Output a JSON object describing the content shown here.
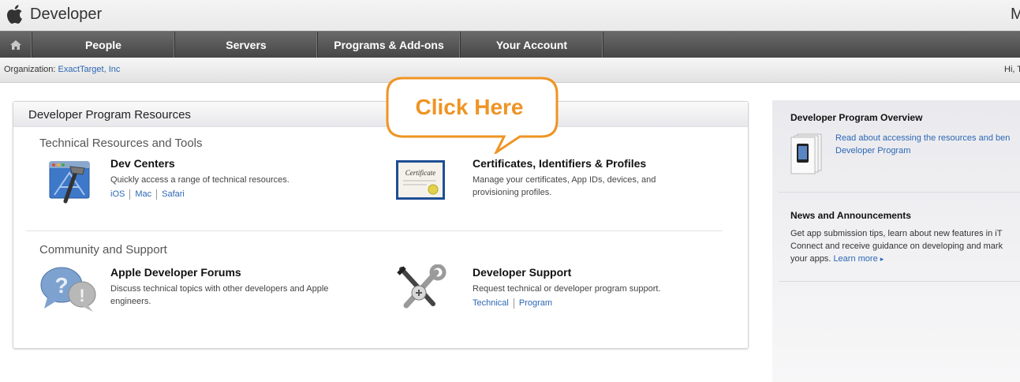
{
  "header": {
    "brand": "Developer",
    "brand_right": "M"
  },
  "nav": {
    "home_icon": "home-icon",
    "items": [
      "People",
      "Servers",
      "Programs & Add-ons",
      "Your Account"
    ]
  },
  "org": {
    "label": "Organization:",
    "name": "ExactTarget, Inc",
    "greeting": "Hi, T"
  },
  "main": {
    "panel_title": "Developer Program Resources",
    "sections": [
      {
        "title": "Technical Resources and Tools",
        "items": [
          {
            "title": "Dev Centers",
            "icon": "xcode-hammer-icon",
            "desc": "Quickly access a range of technical resources.",
            "links": [
              "iOS",
              "Mac",
              "Safari"
            ]
          },
          {
            "title": "Certificates, Identifiers & Profiles",
            "icon": "certificate-icon",
            "icon_text": "Certificate",
            "desc": "Manage your certificates, App IDs, devices, and provisioning profiles.",
            "links": []
          }
        ]
      },
      {
        "title": "Community and Support",
        "items": [
          {
            "title": "Apple Developer Forums",
            "icon": "forums-bubbles-icon",
            "desc": "Discuss technical topics with other developers and Apple engineers.",
            "links": []
          },
          {
            "title": "Developer Support",
            "icon": "wrench-screwdriver-icon",
            "desc": "Request technical or developer program support.",
            "links": [
              "Technical",
              "Program"
            ]
          }
        ]
      }
    ],
    "callout_text": "Click Here"
  },
  "sidebar": {
    "overview": {
      "title": "Developer Program Overview",
      "link_line1": "Read about accessing the resources and ben",
      "link_line2": "Developer Program"
    },
    "news": {
      "title": "News and Announcements",
      "line1": "Get app submission tips, learn about new features in iT",
      "line2": "Connect and receive guidance on developing and mark",
      "line3": "your apps.",
      "learn_more": "Learn more"
    }
  },
  "colors": {
    "link": "#2d67b3",
    "callout": "#ef9424",
    "nav_bg": "#555555"
  }
}
